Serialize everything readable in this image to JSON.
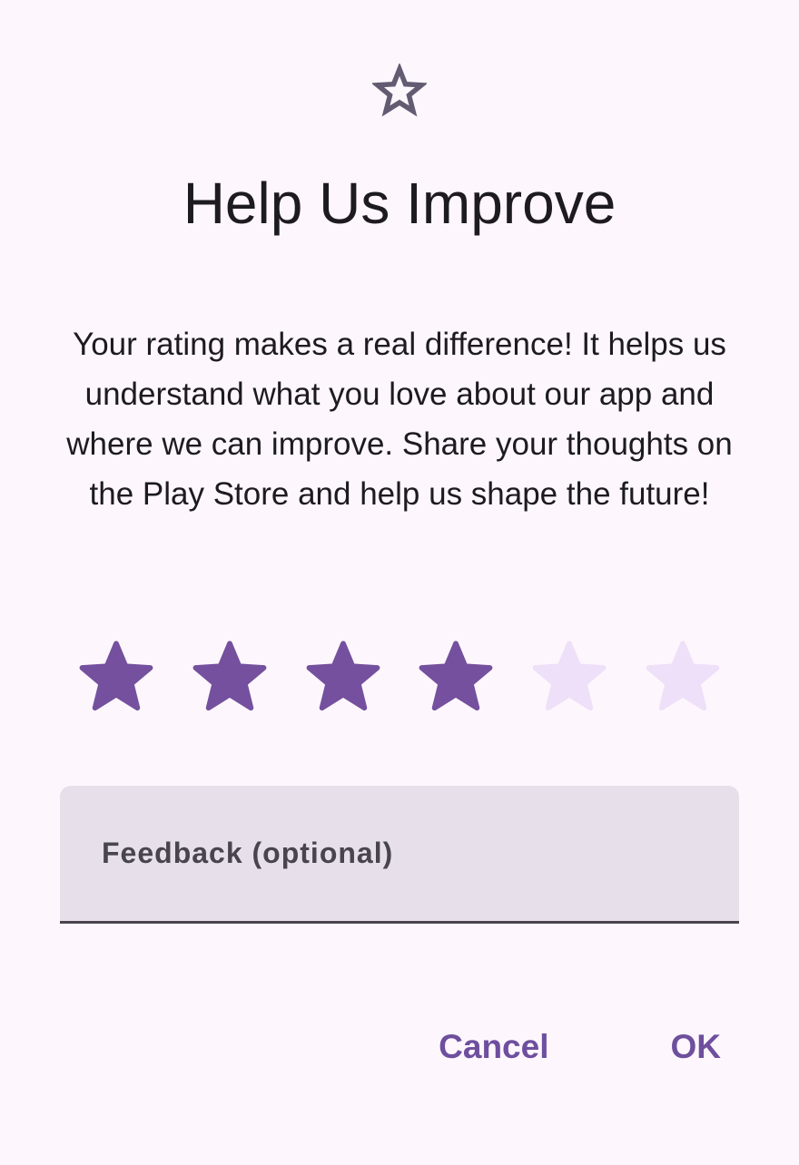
{
  "dialog": {
    "title": "Help Us Improve",
    "message": "Your rating makes a real difference! It helps us understand what you love about our app and where we can improve. Share your thoughts on the Play Store and help us shape the future!",
    "header_icon": "star-outline-icon"
  },
  "rating": {
    "value": 4,
    "max": 6,
    "filled_color": "#74509e",
    "empty_color": "#ede0f8"
  },
  "feedback": {
    "placeholder": "Feedback (optional)",
    "value": ""
  },
  "actions": {
    "cancel_label": "Cancel",
    "ok_label": "OK"
  },
  "colors": {
    "background": "#fdf7fd",
    "accent": "#6e4f9e",
    "field_background": "#e7e0eb",
    "icon": "#625b71"
  }
}
